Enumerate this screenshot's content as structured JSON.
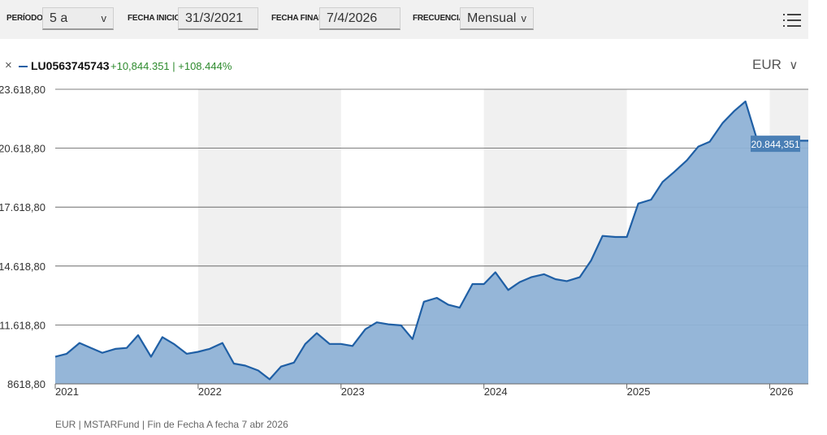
{
  "toolbar": {
    "period_label": "PERÍODO",
    "period_value": "5 a",
    "start_label": "FECHA INICIO",
    "start_value": "31/3/2021",
    "end_label": "FECHA FINAL",
    "end_value": "7/4/2026",
    "freq_label": "FRECUENCIA",
    "freq_value": "Mensual",
    "chevron": "v"
  },
  "legend": {
    "close_symbol": "×",
    "series_id": "LU0563745743",
    "change_text": "+10,844.351 | +108.444%",
    "currency": "EUR",
    "currency_chevron": "∨"
  },
  "footer": {
    "text": "EUR | MSTARFund | Fin de Fecha A fecha 7 abr 2026"
  },
  "colors": {
    "line": "#1f5fa5",
    "area": "#8fb2d6",
    "shade": "#f0f0f0",
    "label_bg": "#4a7fb5",
    "positive": "#2d8a2d"
  },
  "chart_data": {
    "type": "area",
    "title": "",
    "xlabel": "",
    "ylabel": "",
    "ylim": [
      8618.8,
      23618.8
    ],
    "yticks": [
      8618.8,
      11618.8,
      14618.8,
      17618.8,
      20618.8,
      23618.8
    ],
    "ytick_labels": [
      "8618,80",
      "11.618,80",
      "14.618,80",
      "17.618,80",
      "20.618,80",
      "23.618,80"
    ],
    "xticks": [
      "2021",
      "2022",
      "2023",
      "2024",
      "2025",
      "2026"
    ],
    "xtick_positions": [
      2021.0,
      2022.0,
      2023.0,
      2024.0,
      2025.0,
      2026.0
    ],
    "xlim": [
      2021.0,
      2026.27
    ],
    "shaded_years": [
      [
        2022.0,
        2023.0
      ],
      [
        2024.0,
        2025.0
      ],
      [
        2026.0,
        2026.27
      ]
    ],
    "last_value_label": "20.844,351",
    "grid": true,
    "series": [
      {
        "name": "LU0563745743",
        "x": [
          2021.0,
          2021.08,
          2021.17,
          2021.25,
          2021.33,
          2021.42,
          2021.5,
          2021.58,
          2021.67,
          2021.75,
          2021.83,
          2021.92,
          2022.0,
          2022.08,
          2022.17,
          2022.25,
          2022.33,
          2022.42,
          2022.5,
          2022.58,
          2022.67,
          2022.75,
          2022.83,
          2022.92,
          2023.0,
          2023.08,
          2023.17,
          2023.25,
          2023.33,
          2023.42,
          2023.5,
          2023.58,
          2023.67,
          2023.75,
          2023.83,
          2023.92,
          2024.0,
          2024.08,
          2024.17,
          2024.25,
          2024.33,
          2024.42,
          2024.5,
          2024.58,
          2024.67,
          2024.75,
          2024.83,
          2024.92,
          2025.0,
          2025.08,
          2025.17,
          2025.25,
          2025.33,
          2025.42,
          2025.5,
          2025.58,
          2025.67,
          2025.75,
          2025.83,
          2025.92,
          2026.0,
          2026.08,
          2026.27
        ],
        "values": [
          10000,
          10150,
          10700,
          10450,
          10200,
          10400,
          10450,
          11100,
          10000,
          11000,
          10650,
          10150,
          10250,
          10400,
          10700,
          9650,
          9550,
          9300,
          8850,
          9500,
          9700,
          10650,
          11200,
          10650,
          10650,
          10550,
          11400,
          11750,
          11650,
          11600,
          10900,
          12800,
          13000,
          12650,
          12500,
          13700,
          13700,
          14300,
          13400,
          13800,
          14050,
          14200,
          13950,
          13850,
          14050,
          14900,
          16150,
          16100,
          16100,
          17800,
          18000,
          18900,
          19400,
          20000,
          20700,
          20950,
          21900,
          22500,
          23000,
          20844.351,
          20844.351,
          21000,
          21000
        ]
      }
    ]
  }
}
